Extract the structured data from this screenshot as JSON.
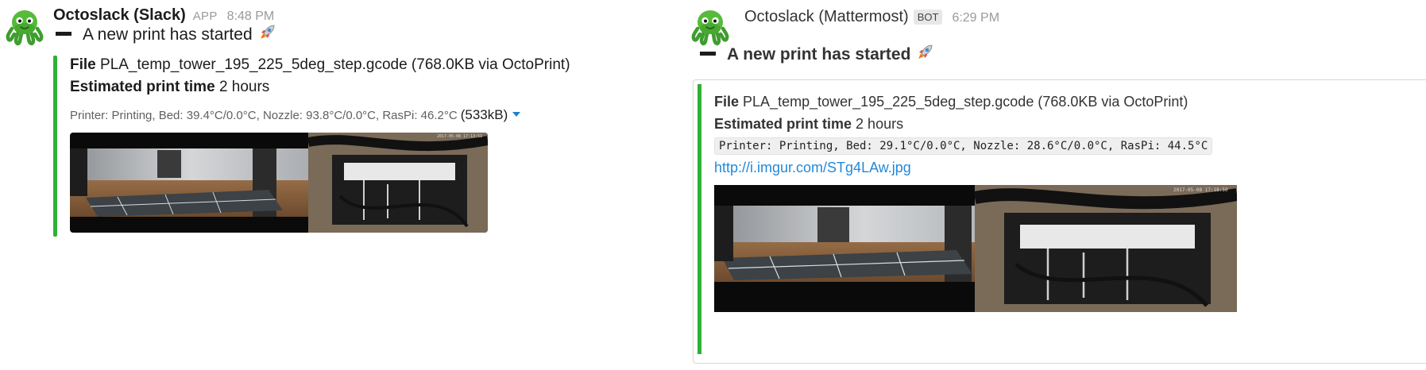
{
  "slack": {
    "author": "Octoslack (Slack)",
    "tag": "APP",
    "time": "8:48 PM",
    "title": "A new print has started",
    "file_label": "File",
    "file_value": "PLA_temp_tower_195_225_5deg_step.gcode (768.0KB via OctoPrint)",
    "est_label": "Estimated print time",
    "est_value": "2 hours",
    "status": "Printer: Printing, Bed: 39.4°C/0.0°C, Nozzle: 93.8°C/0.0°C, RasPi: 46.2°C",
    "image_size": "(533kB)",
    "webcam_timestamp": "2017-05-08 17:13:51"
  },
  "mattermost": {
    "author": "Octoslack (Mattermost)",
    "tag": "BOT",
    "time": "6:29 PM",
    "title": "A new print has started",
    "file_label": "File",
    "file_value": "PLA_temp_tower_195_225_5deg_step.gcode (768.0KB via OctoPrint)",
    "est_label": "Estimated print time",
    "est_value": "2 hours",
    "status": "Printer: Printing, Bed: 29.1°C/0.0°C, Nozzle: 28.6°C/0.0°C, RasPi: 44.5°C",
    "link": "http://i.imgur.com/STg4LAw.jpg",
    "webcam_timestamp": "2017-05-08 17:18:50"
  },
  "icons": {
    "avatar": "octopus-avatar-icon",
    "emoji": "rocket-icon",
    "expand": "caret-down-icon"
  },
  "colors": {
    "attachment_bar": "#2eb135",
    "link": "#2389d7",
    "expand_caret": "#1d7fd4"
  }
}
